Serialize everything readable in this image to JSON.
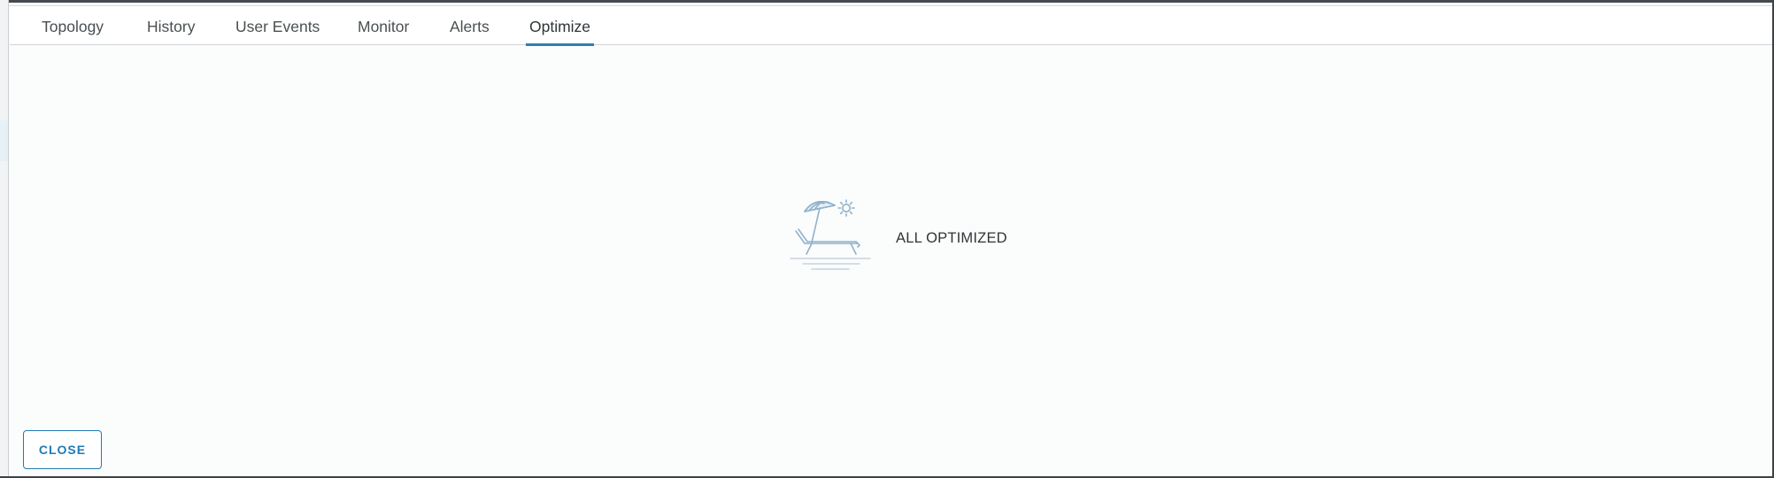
{
  "tabs": [
    {
      "label": "Topology",
      "active": false
    },
    {
      "label": "History",
      "active": false
    },
    {
      "label": "User Events",
      "active": false
    },
    {
      "label": "Monitor",
      "active": false
    },
    {
      "label": "Alerts",
      "active": false
    },
    {
      "label": "Optimize",
      "active": true
    }
  ],
  "empty_state": {
    "icon": "beach-umbrella-lounger-icon",
    "label": "ALL OPTIMIZED"
  },
  "footer": {
    "close_label": "CLOSE"
  },
  "colors": {
    "accent": "#2f7eb1",
    "text": "#2f3437",
    "icon_stroke": "#8fb2cc"
  }
}
